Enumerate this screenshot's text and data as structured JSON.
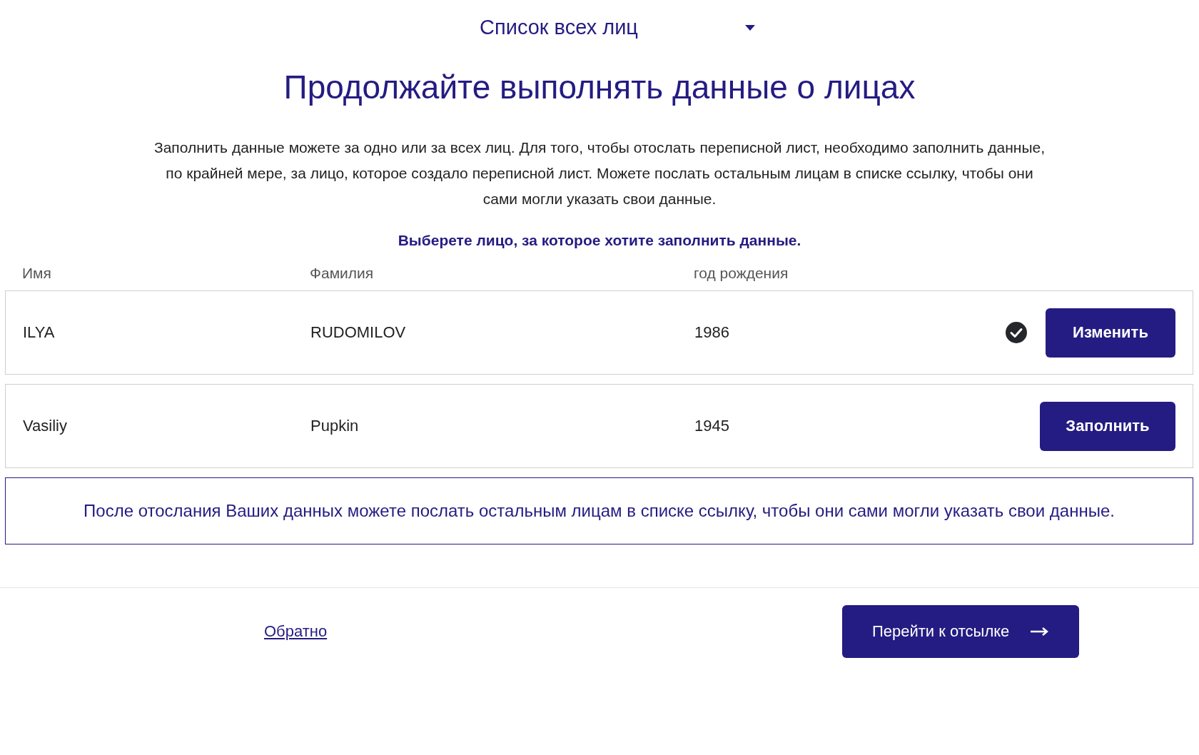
{
  "dropdown": {
    "label": "Список всех лиц"
  },
  "heading": "Продолжайте выполнять данные о лицах",
  "intro": "Заполнить данные можете за одно или за всех лиц. Для того, чтобы отослать переписной лист, необходимо заполнить данные, по крайней мере, за лицо, которое создало переписной лист. Можете послать остальным лицам в списке ссылку, чтобы они сами могли указать свои данные.",
  "prompt": "Выберете лицо, за которое хотите заполнить данные.",
  "table": {
    "columns": [
      "Имя",
      "Фамилия",
      "год рождения"
    ],
    "rows": [
      {
        "first_name": "ILYA",
        "last_name": "RUDOMILOV",
        "birth_year": "1986",
        "completed": true,
        "action": "Изменить"
      },
      {
        "first_name": "Vasiliy",
        "last_name": "Pupkin",
        "birth_year": "1945",
        "completed": false,
        "action": "Заполнить"
      }
    ]
  },
  "notice": "После отослания Ваших данных можете послать остальным лицам в списке ссылку, чтобы они сами могли указать свои данные.",
  "footer": {
    "back_link": "Обратно",
    "next_button": "Перейти к отсылке"
  }
}
